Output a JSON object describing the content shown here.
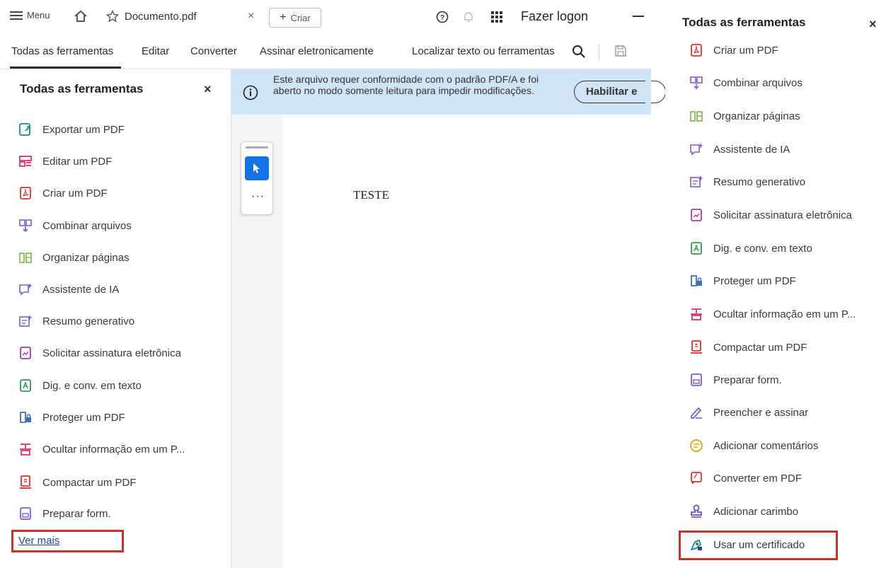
{
  "topbar": {
    "menu_label": "Menu",
    "tab_title": "Documento.pdf",
    "create_label": "Criar",
    "login_label": "Fazer logon"
  },
  "toolbar": {
    "all_tools": "Todas as ferramentas",
    "edit": "Editar",
    "convert": "Converter",
    "esign": "Assinar eletronicamente",
    "search_label": "Localizar texto ou ferramentas"
  },
  "side_panel": {
    "title": "Todas as ferramentas",
    "items": [
      {
        "label": "Exportar um PDF",
        "icon": "export-pdf-icon"
      },
      {
        "label": "Editar um PDF",
        "icon": "edit-pdf-icon"
      },
      {
        "label": "Criar um PDF",
        "icon": "create-pdf-icon"
      },
      {
        "label": "Combinar arquivos",
        "icon": "combine-files-icon"
      },
      {
        "label": "Organizar páginas",
        "icon": "organize-pages-icon"
      },
      {
        "label": "Assistente de IA",
        "icon": "ai-assistant-icon"
      },
      {
        "label": "Resumo generativo",
        "icon": "generative-summary-icon"
      },
      {
        "label": "Solicitar assinatura eletrônica",
        "icon": "request-esign-icon"
      },
      {
        "label": "Dig. e conv. em texto",
        "icon": "scan-ocr-icon"
      },
      {
        "label": "Proteger um PDF",
        "icon": "protect-pdf-icon"
      },
      {
        "label": "Ocultar informação em um P...",
        "icon": "redact-icon"
      },
      {
        "label": "Compactar um PDF",
        "icon": "compress-pdf-icon"
      },
      {
        "label": "Preparar form.",
        "icon": "prepare-form-icon"
      }
    ],
    "see_more": "Ver mais"
  },
  "banner": {
    "message": "Este arquivo requer conformidade com o padrão PDF/A e foi aberto no modo somente leitura para impedir modificações.",
    "button_label": "Habilitar e"
  },
  "document": {
    "text": "TESTE"
  },
  "right_panel": {
    "title": "Todas as ferramentas",
    "items": [
      {
        "label": "Criar um PDF",
        "icon": "create-pdf-icon"
      },
      {
        "label": "Combinar arquivos",
        "icon": "combine-files-icon"
      },
      {
        "label": "Organizar páginas",
        "icon": "organize-pages-icon"
      },
      {
        "label": "Assistente de IA",
        "icon": "ai-assistant-icon"
      },
      {
        "label": "Resumo generativo",
        "icon": "generative-summary-icon"
      },
      {
        "label": "Solicitar assinatura eletrônica",
        "icon": "request-esign-icon"
      },
      {
        "label": "Dig. e conv. em texto",
        "icon": "scan-ocr-icon"
      },
      {
        "label": "Proteger um PDF",
        "icon": "protect-pdf-icon"
      },
      {
        "label": "Ocultar informação em um P...",
        "icon": "redact-icon"
      },
      {
        "label": "Compactar um PDF",
        "icon": "compress-pdf-icon"
      },
      {
        "label": "Preparar form.",
        "icon": "prepare-form-icon"
      },
      {
        "label": "Preencher e assinar",
        "icon": "fill-sign-icon"
      },
      {
        "label": "Adicionar comentários",
        "icon": "add-comments-icon"
      },
      {
        "label": "Converter em PDF",
        "icon": "convert-to-pdf-icon"
      },
      {
        "label": "Adicionar carimbo",
        "icon": "add-stamp-icon"
      },
      {
        "label": "Usar um certificado",
        "icon": "use-certificate-icon"
      }
    ]
  },
  "colors": {
    "highlight_red": "#c8322a",
    "banner_blue": "#cfe4f7",
    "accent_blue": "#1473e6"
  }
}
